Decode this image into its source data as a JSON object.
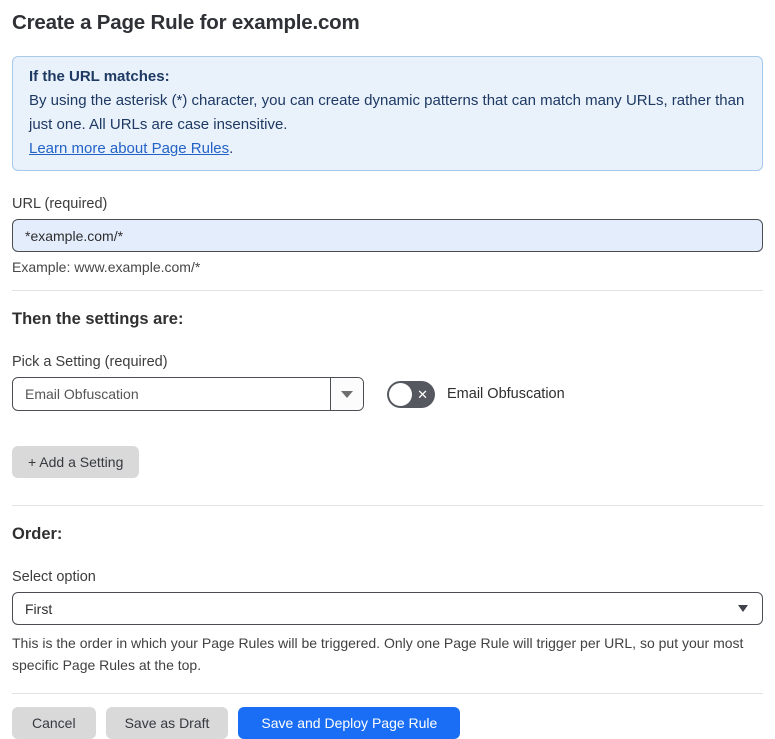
{
  "page": {
    "title": "Create a Page Rule for example.com"
  },
  "info_box": {
    "heading": "If the URL matches:",
    "body": "By using the asterisk (*) character, you can create dynamic patterns that can match many URLs, rather than just one. All URLs are case insensitive.",
    "link_label": "Learn more about Page Rules",
    "link_suffix": "."
  },
  "url_field": {
    "label": "URL (required)",
    "value": "*example.com/*",
    "helper": "Example: www.example.com/*"
  },
  "settings_section": {
    "heading": "Then the settings are:",
    "picker_label": "Pick a Setting (required)",
    "picker_value": "Email Obfuscation",
    "toggle_label": "Email Obfuscation",
    "toggle_state": "off",
    "add_button_label": "+ Add a Setting"
  },
  "order_section": {
    "heading": "Order:",
    "select_label": "Select option",
    "select_value": "First",
    "helper": "This is the order in which your Page Rules will be triggered. Only one Page Rule will trigger per URL, so put your most specific Page Rules at the top."
  },
  "footer": {
    "cancel_label": "Cancel",
    "save_draft_label": "Save as Draft",
    "save_deploy_label": "Save and Deploy Page Rule"
  },
  "icons": {
    "toggle_off_x": "✕",
    "dropdown_arrow": "▼"
  },
  "colors": {
    "accent_blue": "#1a6ef5",
    "info_background": "#e9f1fb",
    "info_border": "#a9c9ec",
    "info_text": "#1e3a63",
    "link_blue": "#2363c8",
    "input_background": "#e4edfc",
    "toggle_off_background": "#55595f",
    "gray_button": "#d9d9d9"
  }
}
